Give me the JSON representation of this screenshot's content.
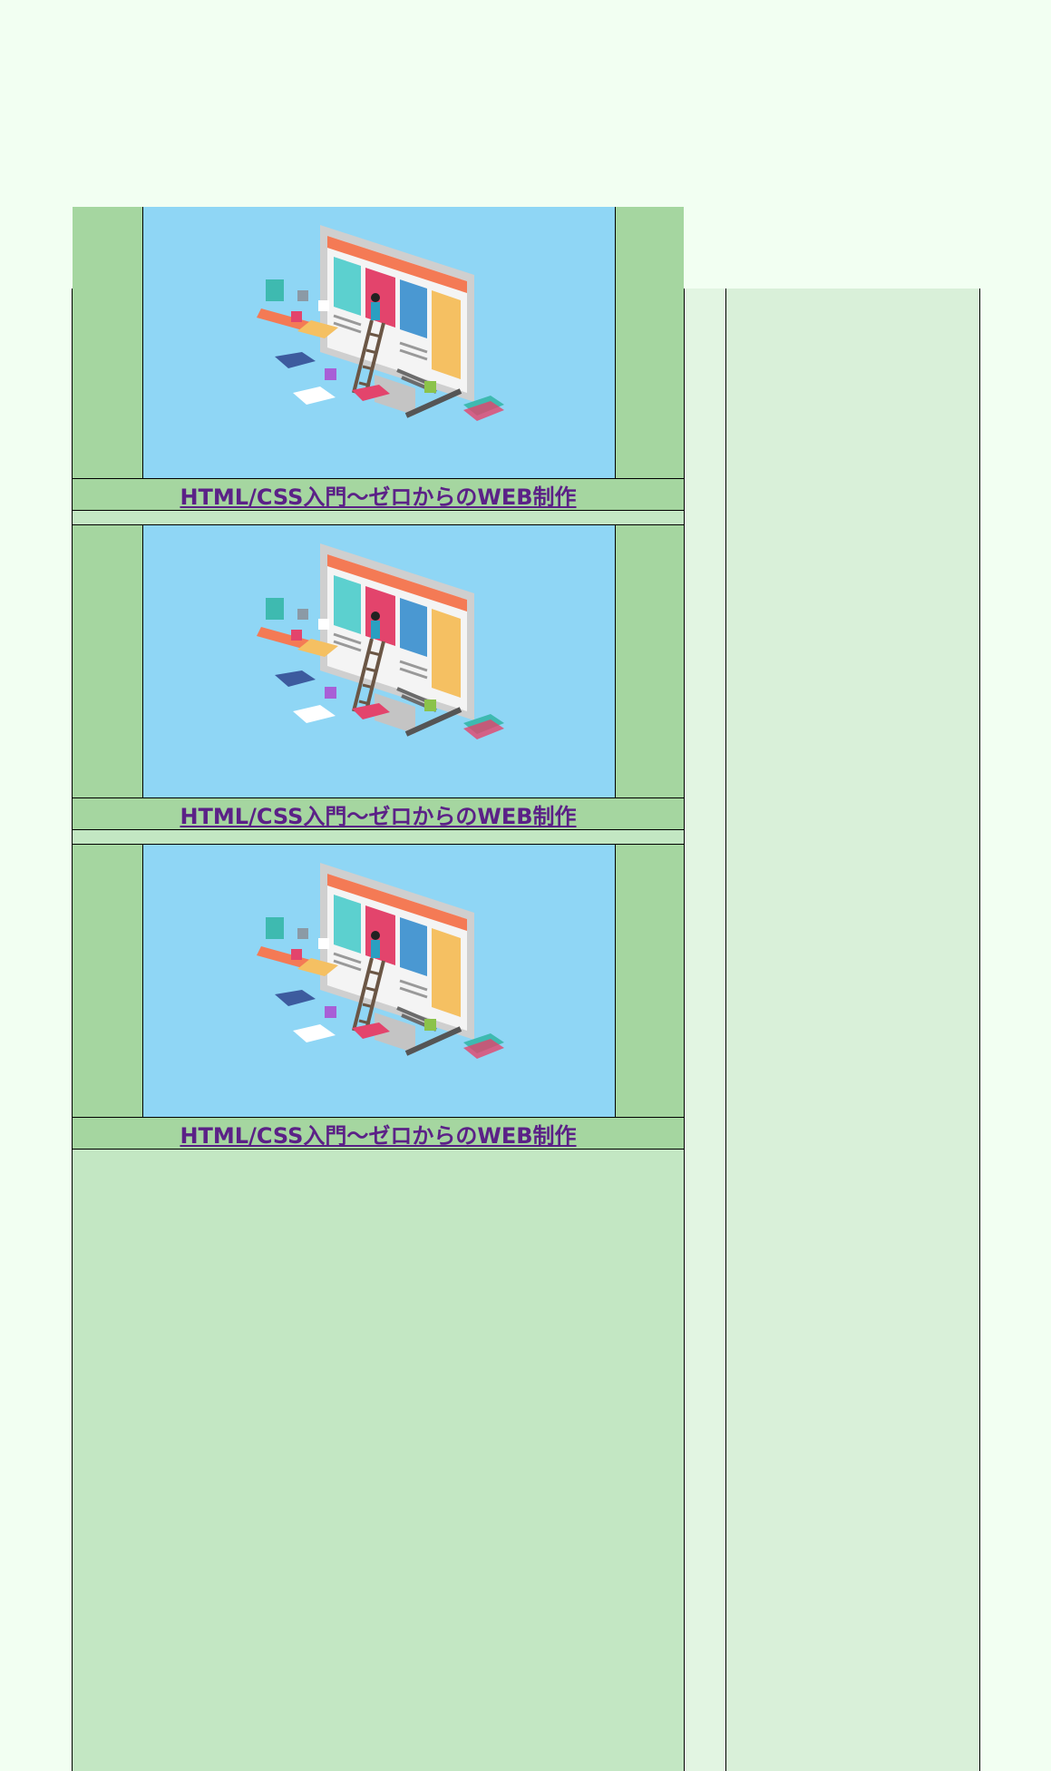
{
  "courses": [
    {
      "title": "HTML/CSS入門〜ゼロからのWEB制作",
      "image_icon": "web-design-illustration-icon"
    },
    {
      "title": "HTML/CSS入門〜ゼロからのWEB制作",
      "image_icon": "web-design-illustration-icon"
    },
    {
      "title": "HTML/CSS入門〜ゼロからのWEB制作",
      "image_icon": "web-design-illustration-icon"
    }
  ],
  "colors": {
    "page_background": "#f2fff2",
    "card_green": "#a5d6a0",
    "image_sky": "#8fd6f5",
    "link_purple": "#5b2187"
  }
}
